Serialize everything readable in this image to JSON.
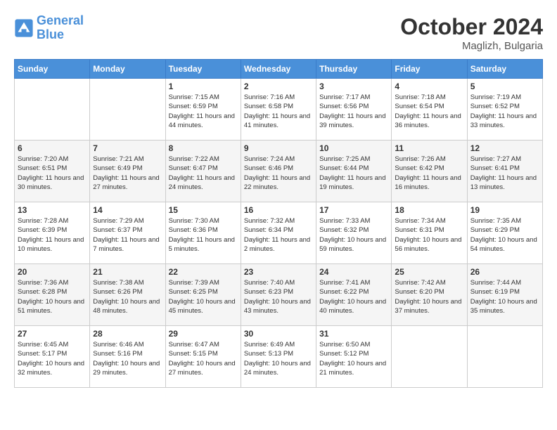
{
  "header": {
    "logo_line1": "General",
    "logo_line2": "Blue",
    "month": "October 2024",
    "location": "Maglizh, Bulgaria"
  },
  "days_of_week": [
    "Sunday",
    "Monday",
    "Tuesday",
    "Wednesday",
    "Thursday",
    "Friday",
    "Saturday"
  ],
  "weeks": [
    [
      {
        "day": "",
        "sunrise": "",
        "sunset": "",
        "daylight": ""
      },
      {
        "day": "",
        "sunrise": "",
        "sunset": "",
        "daylight": ""
      },
      {
        "day": "1",
        "sunrise": "Sunrise: 7:15 AM",
        "sunset": "Sunset: 6:59 PM",
        "daylight": "Daylight: 11 hours and 44 minutes."
      },
      {
        "day": "2",
        "sunrise": "Sunrise: 7:16 AM",
        "sunset": "Sunset: 6:58 PM",
        "daylight": "Daylight: 11 hours and 41 minutes."
      },
      {
        "day": "3",
        "sunrise": "Sunrise: 7:17 AM",
        "sunset": "Sunset: 6:56 PM",
        "daylight": "Daylight: 11 hours and 39 minutes."
      },
      {
        "day": "4",
        "sunrise": "Sunrise: 7:18 AM",
        "sunset": "Sunset: 6:54 PM",
        "daylight": "Daylight: 11 hours and 36 minutes."
      },
      {
        "day": "5",
        "sunrise": "Sunrise: 7:19 AM",
        "sunset": "Sunset: 6:52 PM",
        "daylight": "Daylight: 11 hours and 33 minutes."
      }
    ],
    [
      {
        "day": "6",
        "sunrise": "Sunrise: 7:20 AM",
        "sunset": "Sunset: 6:51 PM",
        "daylight": "Daylight: 11 hours and 30 minutes."
      },
      {
        "day": "7",
        "sunrise": "Sunrise: 7:21 AM",
        "sunset": "Sunset: 6:49 PM",
        "daylight": "Daylight: 11 hours and 27 minutes."
      },
      {
        "day": "8",
        "sunrise": "Sunrise: 7:22 AM",
        "sunset": "Sunset: 6:47 PM",
        "daylight": "Daylight: 11 hours and 24 minutes."
      },
      {
        "day": "9",
        "sunrise": "Sunrise: 7:24 AM",
        "sunset": "Sunset: 6:46 PM",
        "daylight": "Daylight: 11 hours and 22 minutes."
      },
      {
        "day": "10",
        "sunrise": "Sunrise: 7:25 AM",
        "sunset": "Sunset: 6:44 PM",
        "daylight": "Daylight: 11 hours and 19 minutes."
      },
      {
        "day": "11",
        "sunrise": "Sunrise: 7:26 AM",
        "sunset": "Sunset: 6:42 PM",
        "daylight": "Daylight: 11 hours and 16 minutes."
      },
      {
        "day": "12",
        "sunrise": "Sunrise: 7:27 AM",
        "sunset": "Sunset: 6:41 PM",
        "daylight": "Daylight: 11 hours and 13 minutes."
      }
    ],
    [
      {
        "day": "13",
        "sunrise": "Sunrise: 7:28 AM",
        "sunset": "Sunset: 6:39 PM",
        "daylight": "Daylight: 11 hours and 10 minutes."
      },
      {
        "day": "14",
        "sunrise": "Sunrise: 7:29 AM",
        "sunset": "Sunset: 6:37 PM",
        "daylight": "Daylight: 11 hours and 7 minutes."
      },
      {
        "day": "15",
        "sunrise": "Sunrise: 7:30 AM",
        "sunset": "Sunset: 6:36 PM",
        "daylight": "Daylight: 11 hours and 5 minutes."
      },
      {
        "day": "16",
        "sunrise": "Sunrise: 7:32 AM",
        "sunset": "Sunset: 6:34 PM",
        "daylight": "Daylight: 11 hours and 2 minutes."
      },
      {
        "day": "17",
        "sunrise": "Sunrise: 7:33 AM",
        "sunset": "Sunset: 6:32 PM",
        "daylight": "Daylight: 10 hours and 59 minutes."
      },
      {
        "day": "18",
        "sunrise": "Sunrise: 7:34 AM",
        "sunset": "Sunset: 6:31 PM",
        "daylight": "Daylight: 10 hours and 56 minutes."
      },
      {
        "day": "19",
        "sunrise": "Sunrise: 7:35 AM",
        "sunset": "Sunset: 6:29 PM",
        "daylight": "Daylight: 10 hours and 54 minutes."
      }
    ],
    [
      {
        "day": "20",
        "sunrise": "Sunrise: 7:36 AM",
        "sunset": "Sunset: 6:28 PM",
        "daylight": "Daylight: 10 hours and 51 minutes."
      },
      {
        "day": "21",
        "sunrise": "Sunrise: 7:38 AM",
        "sunset": "Sunset: 6:26 PM",
        "daylight": "Daylight: 10 hours and 48 minutes."
      },
      {
        "day": "22",
        "sunrise": "Sunrise: 7:39 AM",
        "sunset": "Sunset: 6:25 PM",
        "daylight": "Daylight: 10 hours and 45 minutes."
      },
      {
        "day": "23",
        "sunrise": "Sunrise: 7:40 AM",
        "sunset": "Sunset: 6:23 PM",
        "daylight": "Daylight: 10 hours and 43 minutes."
      },
      {
        "day": "24",
        "sunrise": "Sunrise: 7:41 AM",
        "sunset": "Sunset: 6:22 PM",
        "daylight": "Daylight: 10 hours and 40 minutes."
      },
      {
        "day": "25",
        "sunrise": "Sunrise: 7:42 AM",
        "sunset": "Sunset: 6:20 PM",
        "daylight": "Daylight: 10 hours and 37 minutes."
      },
      {
        "day": "26",
        "sunrise": "Sunrise: 7:44 AM",
        "sunset": "Sunset: 6:19 PM",
        "daylight": "Daylight: 10 hours and 35 minutes."
      }
    ],
    [
      {
        "day": "27",
        "sunrise": "Sunrise: 6:45 AM",
        "sunset": "Sunset: 5:17 PM",
        "daylight": "Daylight: 10 hours and 32 minutes."
      },
      {
        "day": "28",
        "sunrise": "Sunrise: 6:46 AM",
        "sunset": "Sunset: 5:16 PM",
        "daylight": "Daylight: 10 hours and 29 minutes."
      },
      {
        "day": "29",
        "sunrise": "Sunrise: 6:47 AM",
        "sunset": "Sunset: 5:15 PM",
        "daylight": "Daylight: 10 hours and 27 minutes."
      },
      {
        "day": "30",
        "sunrise": "Sunrise: 6:49 AM",
        "sunset": "Sunset: 5:13 PM",
        "daylight": "Daylight: 10 hours and 24 minutes."
      },
      {
        "day": "31",
        "sunrise": "Sunrise: 6:50 AM",
        "sunset": "Sunset: 5:12 PM",
        "daylight": "Daylight: 10 hours and 21 minutes."
      },
      {
        "day": "",
        "sunrise": "",
        "sunset": "",
        "daylight": ""
      },
      {
        "day": "",
        "sunrise": "",
        "sunset": "",
        "daylight": ""
      }
    ]
  ]
}
